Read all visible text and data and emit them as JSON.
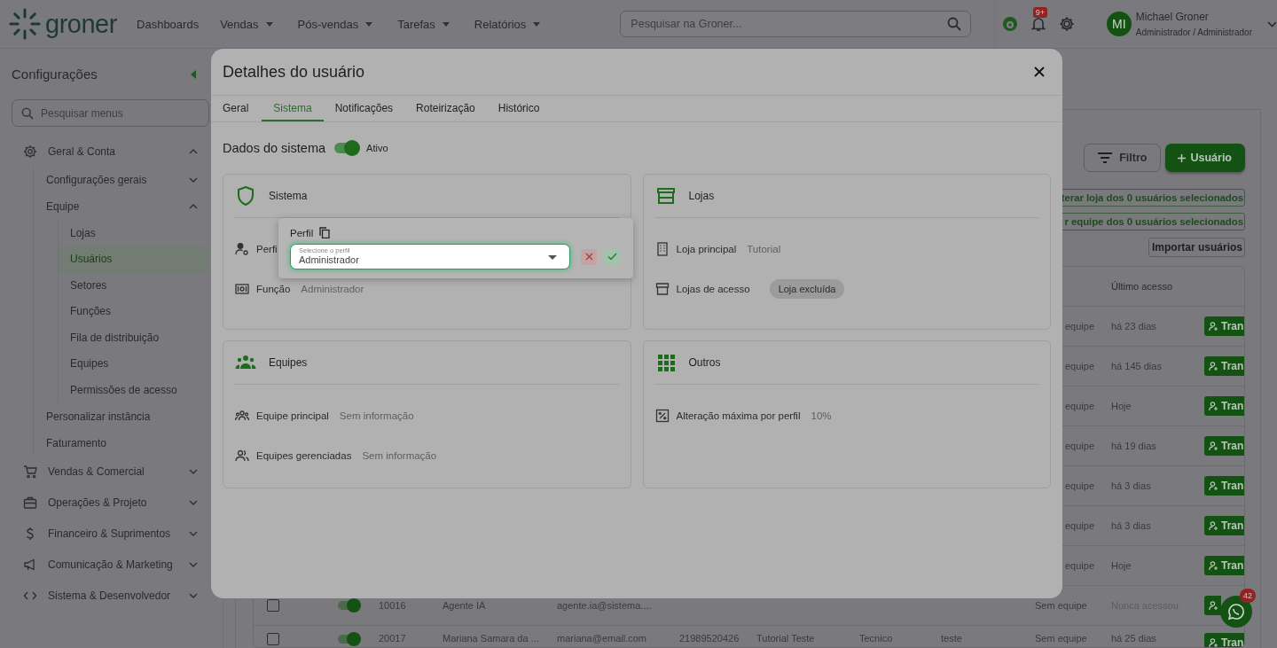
{
  "header": {
    "logo": "groner",
    "nav": [
      {
        "label": "Dashboards",
        "has_menu": false
      },
      {
        "label": "Vendas",
        "has_menu": true
      },
      {
        "label": "Pós-vendas",
        "has_menu": true
      },
      {
        "label": "Tarefas",
        "has_menu": true
      },
      {
        "label": "Relatórios",
        "has_menu": true
      }
    ],
    "search": {
      "placeholder": "Pesquisar na Groner..."
    },
    "notification_badge": "9+",
    "user": {
      "initials": "MI",
      "name": "Michael Groner",
      "role": "Administrador / Administrador"
    }
  },
  "sidebar": {
    "title": "Configurações",
    "search": {
      "placeholder": "Pesquisar menus"
    },
    "items": [
      {
        "label": "Geral & Conta",
        "expanded": true,
        "children": [
          {
            "label": "Configurações gerais",
            "expanded": false
          },
          {
            "label": "Equipe",
            "expanded": true,
            "children": [
              {
                "label": "Lojas",
                "selected": false
              },
              {
                "label": "Usuários",
                "selected": true
              },
              {
                "label": "Setores",
                "selected": false
              },
              {
                "label": "Funções",
                "selected": false
              },
              {
                "label": "Fila de distribuição",
                "selected": false
              },
              {
                "label": "Equipes",
                "selected": false
              },
              {
                "label": "Permissões de acesso",
                "selected": false
              }
            ]
          },
          {
            "label": "Personalizar instância"
          },
          {
            "label": "Faturamento"
          }
        ]
      },
      {
        "label": "Vendas & Comercial",
        "expanded": false
      },
      {
        "label": "Operações & Projeto",
        "expanded": false
      },
      {
        "label": "Financeiro & Suprimentos",
        "expanded": false
      },
      {
        "label": "Comunicação & Marketing",
        "expanded": false
      },
      {
        "label": "Sistema & Desenvolvedor",
        "expanded": false
      }
    ]
  },
  "main": {
    "toolbar": [
      {
        "label": "Filtro",
        "kind": "filter"
      },
      {
        "label": "Usuário",
        "kind": "primary"
      }
    ],
    "bulk_actions": [
      "terar loja dos 0 usuários selecionados",
      "r equipe dos 0 usuários selecionados"
    ],
    "import_button": "Importar usuários",
    "table": {
      "last_access_header": "Último acesso",
      "rows": [
        {
          "kind": "covered",
          "team": "equipe",
          "last_access": "há 23 dias",
          "action": "Tran"
        },
        {
          "kind": "covered",
          "team": "equipe",
          "last_access": "há 145 dias",
          "action": "Tran"
        },
        {
          "kind": "covered",
          "team": "equipe",
          "last_access": "Hoje",
          "action": "Tran"
        },
        {
          "kind": "covered",
          "team": "equipe",
          "last_access": "há 19 dias",
          "action": "Tran"
        },
        {
          "kind": "covered",
          "team": "equipe",
          "last_access": "há 3 dias",
          "action": "Tran"
        },
        {
          "kind": "covered",
          "team": "equipe",
          "last_access": "há 3 dias",
          "action": "Tran"
        },
        {
          "kind": "covered",
          "team": "equipe",
          "last_access": "Hoje",
          "action": "Tran"
        },
        {
          "kind": "full",
          "checked": false,
          "active": true,
          "id": "10016",
          "name": "Agente IA",
          "email": "agente.ia@sistema....",
          "team": "Sem equipe",
          "last_access": "Nunca acessou"
        },
        {
          "kind": "full",
          "checked": false,
          "active": true,
          "id": "20017",
          "name": "Mariana Samara da ...",
          "email": "mariana@email.com",
          "phone": "21989520426",
          "store": "Tutorial Teste",
          "function": "Tecnico",
          "group": "teste",
          "team": "Sem equipe",
          "last_access": "há 25 dias",
          "action": "Tran"
        }
      ]
    }
  },
  "modal": {
    "title": "Detalhes do usuário",
    "tabs": [
      {
        "label": "Geral",
        "selected": false
      },
      {
        "label": "Sistema",
        "selected": true
      },
      {
        "label": "Notificações",
        "selected": false
      },
      {
        "label": "Roteirização",
        "selected": false
      },
      {
        "label": "Histórico",
        "selected": false
      }
    ],
    "section_title": "Dados do sistema",
    "active": {
      "on": true,
      "label": "Ativo"
    },
    "cards": [
      {
        "title": "Sistema",
        "rows": [
          {
            "label": "Perfi"
          },
          {
            "label": "Função",
            "value": "Administrador"
          }
        ]
      },
      {
        "title": "Lojas",
        "rows": [
          {
            "label": "Loja principal",
            "value": "Tutorial"
          },
          {
            "label": "Lojas de acesso",
            "chip": "Loja excluída"
          }
        ]
      },
      {
        "title": "Equipes",
        "rows": [
          {
            "label": "Equipe principal",
            "value": "Sem informação"
          },
          {
            "label": "Equipes gerenciadas",
            "value": "Sem informação"
          }
        ]
      },
      {
        "title": "Outros",
        "rows": [
          {
            "label": "Alteração máxima por perfil",
            "value": "10%"
          }
        ]
      }
    ],
    "profile_editor": {
      "label": "Perfil",
      "field_label": "Selecione o perfil",
      "value": "Administrador"
    }
  },
  "whatsapp": {
    "badge": "42"
  }
}
